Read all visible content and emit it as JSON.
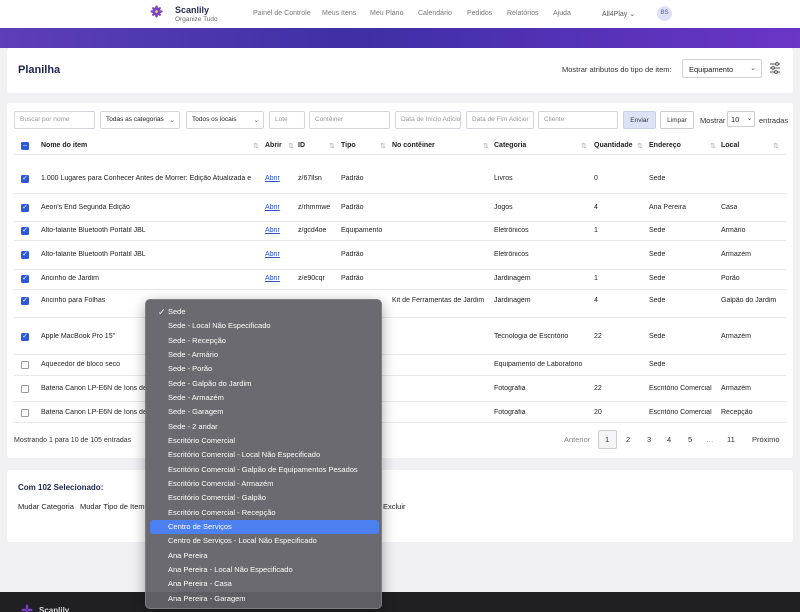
{
  "brand": {
    "name": "Scanlily",
    "slogan": "Organize Tudo"
  },
  "nav": {
    "links": [
      "Painel de Controle",
      "Meus Itens",
      "Meu Plano",
      "Calendário",
      "Pedidos",
      "Relatórios",
      "Ajuda"
    ],
    "account": "All4Play",
    "avatar": "BS"
  },
  "header": {
    "title": "Planilha",
    "attr_label": "Mostrar atributos do tipo de item:",
    "attr_value": "Equipamento"
  },
  "filters": {
    "search": "Buscar por nome",
    "categories": "Todas as categorias",
    "locations": "Todos os locais",
    "lote": "Lote",
    "container": "Contêiner",
    "start_date": "Data de Início Adicio",
    "end_date": "Data de Fim Adicior",
    "client": "Cliente",
    "send": "Enviar",
    "clear": "Limpar",
    "show": "Mostrar",
    "show_value": "10",
    "entries": "entradas"
  },
  "table": {
    "headers": [
      "Nome do item",
      "Abrir",
      "ID",
      "Tipo",
      "No contêiner",
      "Categoria",
      "Quantidade",
      "Endereço",
      "Local"
    ],
    "rows": [
      {
        "checked": true,
        "name": "1.000 Lugares para Conhecer Antes de Morrer: Edição Atualizada e",
        "open": "Abrir",
        "id": "z/67llsn",
        "type": "Padrão",
        "container": "",
        "category": "Livros",
        "qty": "0",
        "address": "Sede",
        "local": ""
      },
      {
        "checked": true,
        "name": "Aeon's End Segunda Edição",
        "open": "Abrir",
        "id": "z/rhmmwe",
        "type": "Padrão",
        "container": "",
        "category": "Jogos",
        "qty": "4",
        "address": "Ana Pereira",
        "local": "Casa"
      },
      {
        "checked": true,
        "name": "Alto-falante Bluetooth Portátil JBL",
        "open": "Abrir",
        "id": "z/gcd4oe",
        "type": "Equipamento",
        "container": "",
        "category": "Eletrônicos",
        "qty": "1",
        "address": "Sede",
        "local": "Armário"
      },
      {
        "checked": true,
        "name": "Alto-falante Bluetooth Portátil JBL",
        "open": "Abrir",
        "id": "",
        "type": "Padrão",
        "container": "",
        "category": "Eletrônicos",
        "qty": "",
        "address": "Sede",
        "local": "Armazém"
      },
      {
        "checked": true,
        "name": "Ancinho de Jardim",
        "open": "Abrir",
        "id": "z/e90cqr",
        "type": "Padrão",
        "container": "",
        "category": "Jardinagem",
        "qty": "1",
        "address": "Sede",
        "local": "Porão"
      },
      {
        "checked": true,
        "name": "Ancinho para Folhas",
        "open": "",
        "id": "",
        "type": "",
        "container": "Kit de Ferramentas de Jardim",
        "category": "Jardinagem",
        "qty": "4",
        "address": "Sede",
        "local": "Galpão do Jardim"
      },
      {
        "checked": true,
        "name": "Apple MacBook Pro 15\"",
        "open": "",
        "id": "",
        "type": "",
        "container": "",
        "category": "Tecnologia de Escritório",
        "qty": "22",
        "address": "Sede",
        "local": "Armazém"
      },
      {
        "checked": false,
        "name": "Aquecedor de bloco seco",
        "open": "",
        "id": "",
        "type": "",
        "container": "",
        "category": "Equipamento de Laboratório",
        "qty": "",
        "address": "Sede",
        "local": ""
      },
      {
        "checked": false,
        "name": "Bateria Canon LP-E6N de Íons de",
        "open": "",
        "id": "",
        "type": "",
        "container": "",
        "category": "Fotografia",
        "qty": "22",
        "address": "Escritório Comercial",
        "local": "Armazém"
      },
      {
        "checked": false,
        "name": "Bateria Canon LP-E6N de Íons de",
        "open": "",
        "id": "",
        "type": "",
        "container": "",
        "category": "Fotografia",
        "qty": "20",
        "address": "Escritório Comercial",
        "local": "Recepção"
      }
    ]
  },
  "pagination": {
    "showing": "Mostrando 1 para 10 de 105 entradas",
    "prev": "Anterior",
    "pages": [
      "1",
      "2",
      "3",
      "4",
      "5",
      "…",
      "11"
    ],
    "next": "Próximo"
  },
  "selection": {
    "title": "Com 102 Selecionado:",
    "actions": [
      "Mudar Categoria",
      "Mudar Tipo de Item",
      "Excluir"
    ]
  },
  "dropdown": {
    "options": [
      "Sede",
      "Sede - Local Não Especificado",
      "Sede - Recepção",
      "Sede - Armário",
      "Sede - Porão",
      "Sede - Galpão do Jardim",
      "Sede - Armazém",
      "Sede - Garagem",
      "Sede - 2 andar",
      "Escritório Comercial",
      "Escritório Comercial - Local Não Especificado",
      "Escritório Comercial - Galpão de Equipamentos Pesados",
      "Escritório Comercial - Armazém",
      "Escritório Comercial - Galpão",
      "Escritório Comercial - Recepção",
      "Centro de Serviços",
      "Centro de Serviços - Local Não Especificado",
      "Ana Pereira",
      "Ana Pereira - Local Não Especificado",
      "Ana Pereira - Casa",
      "Ana Pereira - Garagem"
    ],
    "checked_index": 0,
    "highlighted_index": 15
  },
  "colors": {
    "accent": "#2f58d6",
    "banner": "#4a33b0",
    "highlight": "#4c7ff0"
  }
}
